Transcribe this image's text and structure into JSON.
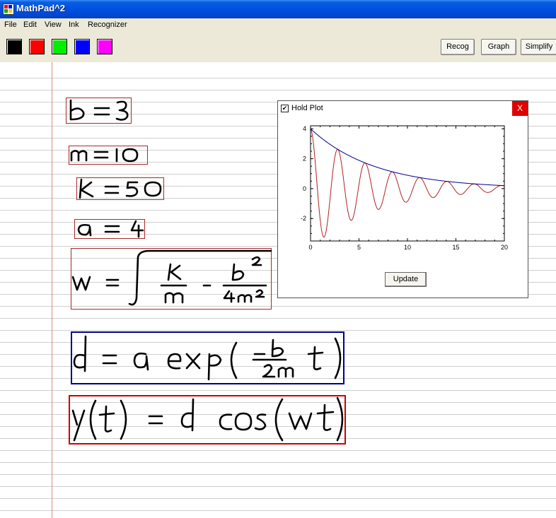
{
  "window": {
    "title": "MathPad^2"
  },
  "menu": [
    "File",
    "Edit",
    "View",
    "Ink",
    "Recognizer"
  ],
  "palette": [
    {
      "name": "black",
      "color": "#000000"
    },
    {
      "name": "red",
      "color": "#ff0000"
    },
    {
      "name": "green",
      "color": "#00ee00"
    },
    {
      "name": "blue",
      "color": "#0000ff"
    },
    {
      "name": "magenta",
      "color": "#ff00ff"
    }
  ],
  "buttons": {
    "recog": "Recog",
    "graph": "Graph",
    "simplify": "Simplify"
  },
  "equations": [
    {
      "id": "b",
      "text": "b = 3",
      "box_color": "#a52a2a"
    },
    {
      "id": "m",
      "text": "m = 10",
      "box_color": "#a52a2a"
    },
    {
      "id": "k",
      "text": "k = 50",
      "box_color": "#a52a2a"
    },
    {
      "id": "a",
      "text": "a = 4",
      "box_color": "#a52a2a"
    },
    {
      "id": "w",
      "text": "w = sqrt(k/m - b^2/(4m^2))",
      "box_color": "#a52a2a"
    },
    {
      "id": "d",
      "text": "d = a exp(-b/(2m) t)",
      "box_color": "#00008b"
    },
    {
      "id": "y",
      "text": "y(t) = d cos(w t)",
      "box_color": "#cc0000"
    }
  ],
  "plot": {
    "hold_label": "Hold Plot",
    "hold_checked": true,
    "close_label": "X",
    "update_label": "Update",
    "chart_data": {
      "type": "line",
      "xlim": [
        0,
        20
      ],
      "ylim": [
        -3.5,
        4.2
      ],
      "xticks": [
        "0",
        "5",
        "10",
        "15",
        "20"
      ],
      "yticks": [
        "4",
        "2",
        "0",
        "-2"
      ],
      "series": [
        {
          "color": "#00008b",
          "formula": "d(t) = 4 exp(-0.15 t)",
          "x": [
            0,
            2,
            4,
            6,
            8,
            10,
            12,
            14,
            16,
            18,
            20
          ],
          "y": [
            4.0,
            2.96,
            2.2,
            1.63,
            1.2,
            0.89,
            0.66,
            0.49,
            0.36,
            0.27,
            0.2
          ]
        },
        {
          "color": "#b22222",
          "formula": "y(t) = 4 exp(-0.15 t) cos(2.229 t)",
          "x": [
            0,
            1.41,
            2.82,
            4.23,
            5.64,
            7.05,
            8.46,
            9.87,
            11.28,
            12.69,
            14.1,
            15.51,
            16.92,
            18.33,
            19.74
          ],
          "y": [
            4.0,
            -3.24,
            2.62,
            -2.12,
            1.72,
            -1.39,
            1.12,
            -0.91,
            0.74,
            -0.6,
            0.48,
            -0.39,
            0.32,
            -0.26,
            0.21
          ]
        }
      ]
    }
  }
}
